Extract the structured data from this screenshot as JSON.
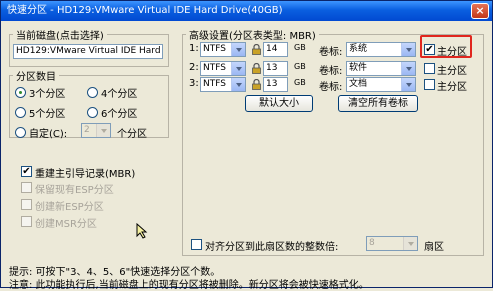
{
  "window": {
    "title": "快速分区 - HD129:VMware Virtual IDE Hard Drive(40GB)",
    "close_glyph": "×"
  },
  "current_disk": {
    "group_label": "当前磁盘(点击选择)",
    "value": "HD129:VMware Virtual IDE Hard Drive"
  },
  "partition_count": {
    "group_label": "分区数目",
    "options": [
      {
        "label": "3个分区",
        "selected": true
      },
      {
        "label": "4个分区",
        "selected": false
      },
      {
        "label": "5个分区",
        "selected": false
      },
      {
        "label": "6个分区",
        "selected": false
      }
    ],
    "custom_label": "自定(C):",
    "custom_value": "2",
    "custom_unit": "个分区"
  },
  "options": {
    "rebuild_mbr": "重建主引导记录(MBR)",
    "keep_esp": "保留现有ESP分区",
    "create_esp": "创建新ESP分区",
    "create_msr": "创建MSR分区"
  },
  "advanced": {
    "group_label": "高级设置(分区表类型: MBR)",
    "rows": [
      {
        "index": "1:",
        "fs": "NTFS",
        "size": "14",
        "unit": "GB",
        "label_text": "卷标:",
        "label": "系统",
        "primary": true
      },
      {
        "index": "2:",
        "fs": "NTFS",
        "size": "13",
        "unit": "GB",
        "label_text": "卷标:",
        "label": "软件",
        "primary": false
      },
      {
        "index": "3:",
        "fs": "NTFS",
        "size": "13",
        "unit": "GB",
        "label_text": "卷标:",
        "label": "文档",
        "primary": false
      }
    ],
    "primary_label": "主分区",
    "default_size_button": "默认大小",
    "clear_labels_button": "清空所有卷标",
    "align_label": "对齐分区到此扇区数的整数倍:",
    "align_value": "8",
    "align_unit": "扇区"
  },
  "footer": {
    "tip": "提示:  可按下\"3、4、5、6\"快速选择分区个数。",
    "note": "注意:  此功能执行后,当前磁盘上的现有分区将被删除。新分区将会被快速格式化。"
  }
}
